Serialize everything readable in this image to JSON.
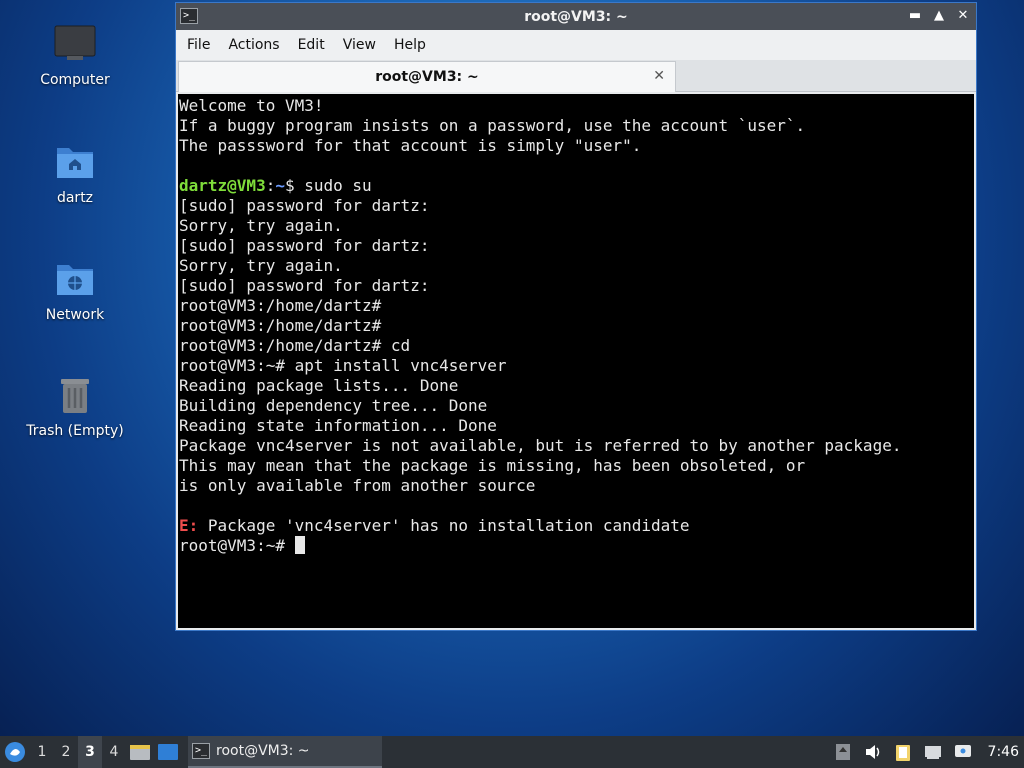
{
  "desktop": {
    "icons": [
      {
        "label": "Computer"
      },
      {
        "label": "dartz"
      },
      {
        "label": "Network"
      },
      {
        "label": "Trash (Empty)"
      }
    ]
  },
  "window": {
    "title": "root@VM3: ~",
    "controls": {
      "minimize": "▬",
      "maximize": "▲",
      "close": "✕"
    },
    "menu": [
      "File",
      "Actions",
      "Edit",
      "View",
      "Help"
    ],
    "tab": {
      "label": "root@VM3: ~",
      "close": "✕"
    }
  },
  "terminal": {
    "lines": [
      "Welcome to VM3!",
      "If a buggy program insists on a password, use the account `user`.",
      "The passsword for that account is simply \"user\".",
      "",
      {
        "user": "dartz@VM3",
        "sep": ":",
        "path": "~",
        "rest": "$ sudo su"
      },
      "[sudo] password for dartz:",
      "Sorry, try again.",
      "[sudo] password for dartz:",
      "Sorry, try again.",
      "[sudo] password for dartz:",
      "root@VM3:/home/dartz#",
      "root@VM3:/home/dartz#",
      "root@VM3:/home/dartz# cd",
      "root@VM3:~# apt install vnc4server",
      "Reading package lists... Done",
      "Building dependency tree... Done",
      "Reading state information... Done",
      "Package vnc4server is not available, but is referred to by another package.",
      "This may mean that the package is missing, has been obsoleted, or",
      "is only available from another source",
      "",
      {
        "error": "E:",
        "rest": " Package 'vnc4server' has no installation candidate"
      },
      {
        "prompt": "root@VM3:~# "
      }
    ]
  },
  "taskbar": {
    "workspaces": [
      "1",
      "2",
      "3",
      "4"
    ],
    "active_workspace": "3",
    "task_label": "root@VM3: ~",
    "clock": "7:46"
  },
  "colors": {
    "terminal_bg": "#000000",
    "prompt_user": "#7fdd3a",
    "prompt_path": "#6c9cff",
    "error": "#ef4d4d",
    "window_border": "#3b78c8"
  }
}
